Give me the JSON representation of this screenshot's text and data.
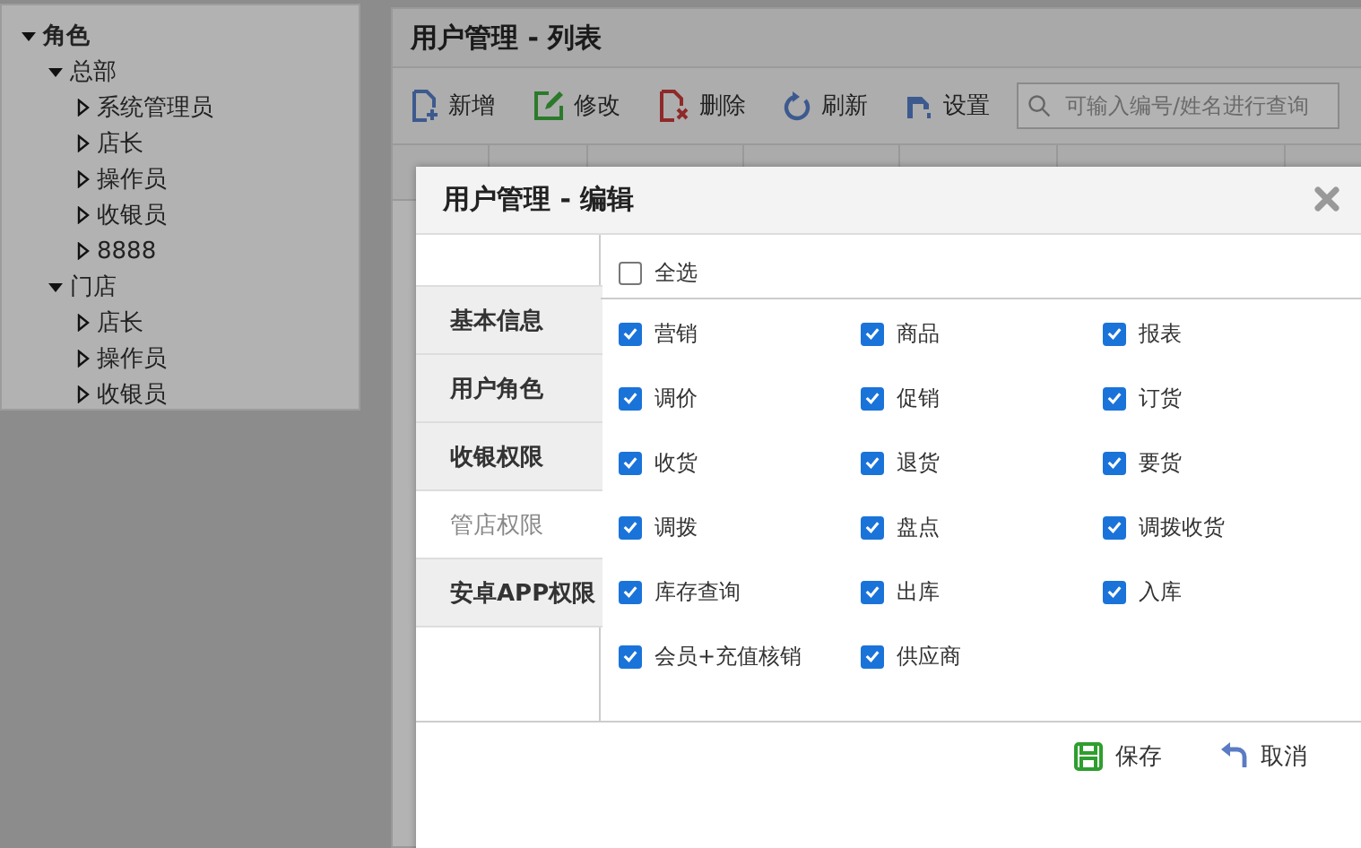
{
  "role_tree": {
    "label": "角色",
    "expanded": true,
    "children": [
      {
        "label": "总部",
        "expanded": true,
        "children": [
          {
            "label": "系统管理员",
            "expanded": false
          },
          {
            "label": "店长",
            "expanded": false
          },
          {
            "label": "操作员",
            "expanded": false
          },
          {
            "label": "收银员",
            "expanded": false
          },
          {
            "label": "8888",
            "expanded": false
          }
        ]
      },
      {
        "label": "门店",
        "expanded": true,
        "children": [
          {
            "label": "店长",
            "expanded": false
          },
          {
            "label": "操作员",
            "expanded": false
          },
          {
            "label": "收银员",
            "expanded": false
          }
        ]
      }
    ]
  },
  "list_panel": {
    "title": "用户管理 - 列表",
    "toolbar": [
      {
        "label": "新增",
        "kind": "add"
      },
      {
        "label": "修改",
        "kind": "edit"
      },
      {
        "label": "删除",
        "kind": "delete"
      },
      {
        "label": "刷新",
        "kind": "refresh"
      },
      {
        "label": "设置",
        "kind": "settings"
      }
    ],
    "search": {
      "placeholder": "可输入编号/姓名进行查询"
    }
  },
  "dialog": {
    "title": "用户管理 - 编辑",
    "tabs": [
      {
        "label": "基本信息",
        "selected": false
      },
      {
        "label": "用户角色",
        "selected": false
      },
      {
        "label": "收银权限",
        "selected": false
      },
      {
        "label": "管店权限",
        "selected": true
      },
      {
        "label": "安卓APP权限",
        "selected": false
      }
    ],
    "select_all": {
      "label": "全选",
      "checked": false
    },
    "permissions": [
      {
        "label": "营销",
        "checked": true
      },
      {
        "label": "商品",
        "checked": true
      },
      {
        "label": "报表",
        "checked": true
      },
      {
        "label": "调价",
        "checked": true
      },
      {
        "label": "促销",
        "checked": true
      },
      {
        "label": "订货",
        "checked": true
      },
      {
        "label": "收货",
        "checked": true
      },
      {
        "label": "退货",
        "checked": true
      },
      {
        "label": "要货",
        "checked": true
      },
      {
        "label": "调拨",
        "checked": true
      },
      {
        "label": "盘点",
        "checked": true
      },
      {
        "label": "调拨收货",
        "checked": true
      },
      {
        "label": "库存查询",
        "checked": true
      },
      {
        "label": "出库",
        "checked": true
      },
      {
        "label": "入库",
        "checked": true
      },
      {
        "label": "会员+充值核销",
        "checked": true
      },
      {
        "label": "供应商",
        "checked": true
      }
    ],
    "buttons": [
      {
        "label": "保存",
        "kind": "save"
      },
      {
        "label": "取消",
        "kind": "cancel"
      }
    ]
  }
}
